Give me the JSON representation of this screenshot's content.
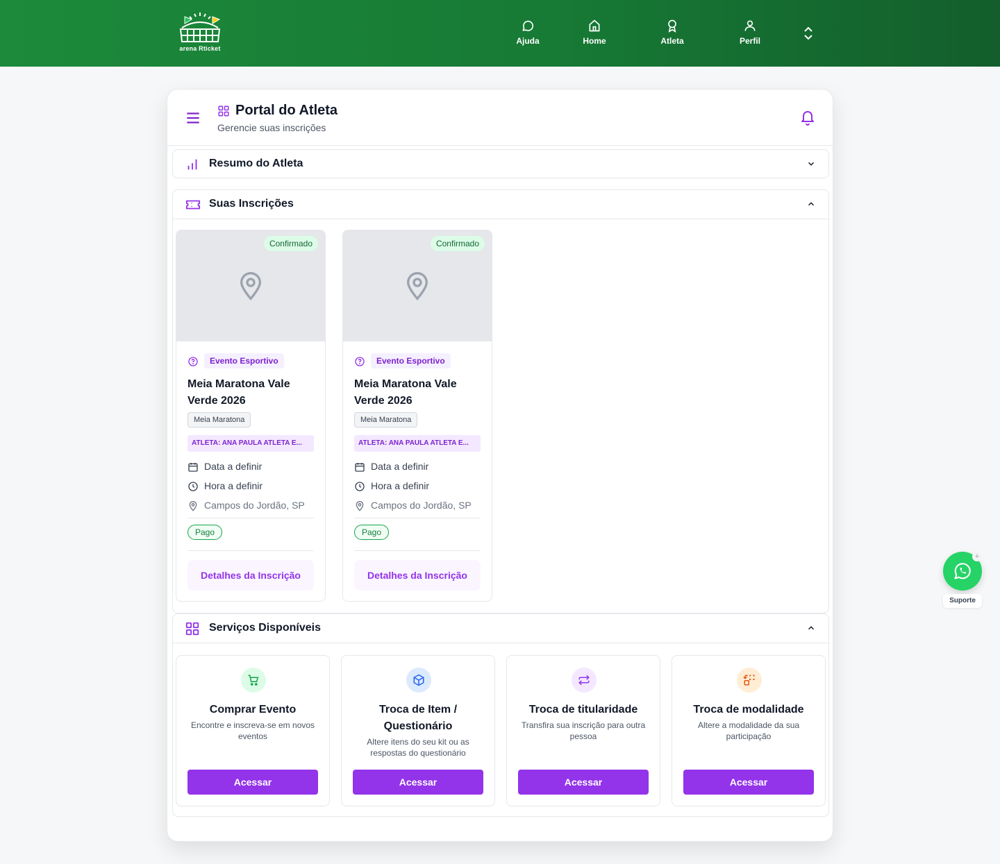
{
  "header": {
    "logo_text": "arena Rticket",
    "nav": [
      {
        "label": "Ajuda",
        "icon": "chat-icon"
      },
      {
        "label": "Home",
        "icon": "home-icon"
      },
      {
        "label": "Atleta",
        "icon": "medal-icon"
      },
      {
        "label": "Perfil",
        "icon": "user-icon"
      }
    ],
    "toggle_icon": "chevron-up-down-icon"
  },
  "portal": {
    "title": "Portal do Atleta",
    "subtitle": "Gerencie suas inscrições",
    "title_icon": "grid-icon",
    "bell_icon": "bell-icon"
  },
  "sections": {
    "summary": {
      "title": "Resumo do Atleta",
      "icon": "bar-chart-icon",
      "expanded": false
    },
    "registrations": {
      "title": "Suas Inscrições",
      "icon": "ticket-icon",
      "expanded": true
    },
    "services": {
      "title": "Serviços Disponíveis",
      "icon": "grid-icon",
      "expanded": true
    }
  },
  "registrations": [
    {
      "status": "Confirmado",
      "category": "Evento Esportivo",
      "title": "Meia Maratona Vale Verde 2026",
      "modality": "Meia Maratona",
      "athlete": "ATLETA: ANA PAULA ATLETA E...",
      "date": "Data a definir",
      "time": "Hora a definir",
      "location": "Campos do Jordão, SP",
      "payment": "Pago",
      "button": "Detalhes da Inscrição"
    },
    {
      "status": "Confirmado",
      "category": "Evento Esportivo",
      "title": "Meia Maratona Vale Verde 2026",
      "modality": "Meia Maratona",
      "athlete": "ATLETA: ANA PAULA ATLETA E...",
      "date": "Data a definir",
      "time": "Hora a definir",
      "location": "Campos do Jordão, SP",
      "payment": "Pago",
      "button": "Detalhes da Inscrição"
    }
  ],
  "services": [
    {
      "title": "Comprar Evento",
      "description": "Encontre e inscreva-se em novos eventos",
      "button": "Acessar",
      "icon": "cart-icon",
      "color": "#16a34a",
      "bg": "#dcfce7"
    },
    {
      "title": "Troca de Item / Questionário",
      "description": "Altere itens do seu kit ou as respostas do questionário",
      "button": "Acessar",
      "icon": "box-icon",
      "color": "#2563eb",
      "bg": "#dbeafe"
    },
    {
      "title": "Troca de titularidade",
      "description": "Transfira sua inscrição para outra pessoa",
      "button": "Acessar",
      "icon": "swap-icon",
      "color": "#9333ea",
      "bg": "#f3e8ff"
    },
    {
      "title": "Troca de modalidade",
      "description": "Altere a modalidade da sua participação",
      "button": "Acessar",
      "icon": "exchange-icon",
      "color": "#ea580c",
      "bg": "#ffedd5"
    }
  ],
  "support": {
    "label": "Suporte",
    "icon": "whatsapp-icon"
  },
  "colors": {
    "header_green": "#1c8a3a",
    "accent_purple": "#9333ea"
  }
}
